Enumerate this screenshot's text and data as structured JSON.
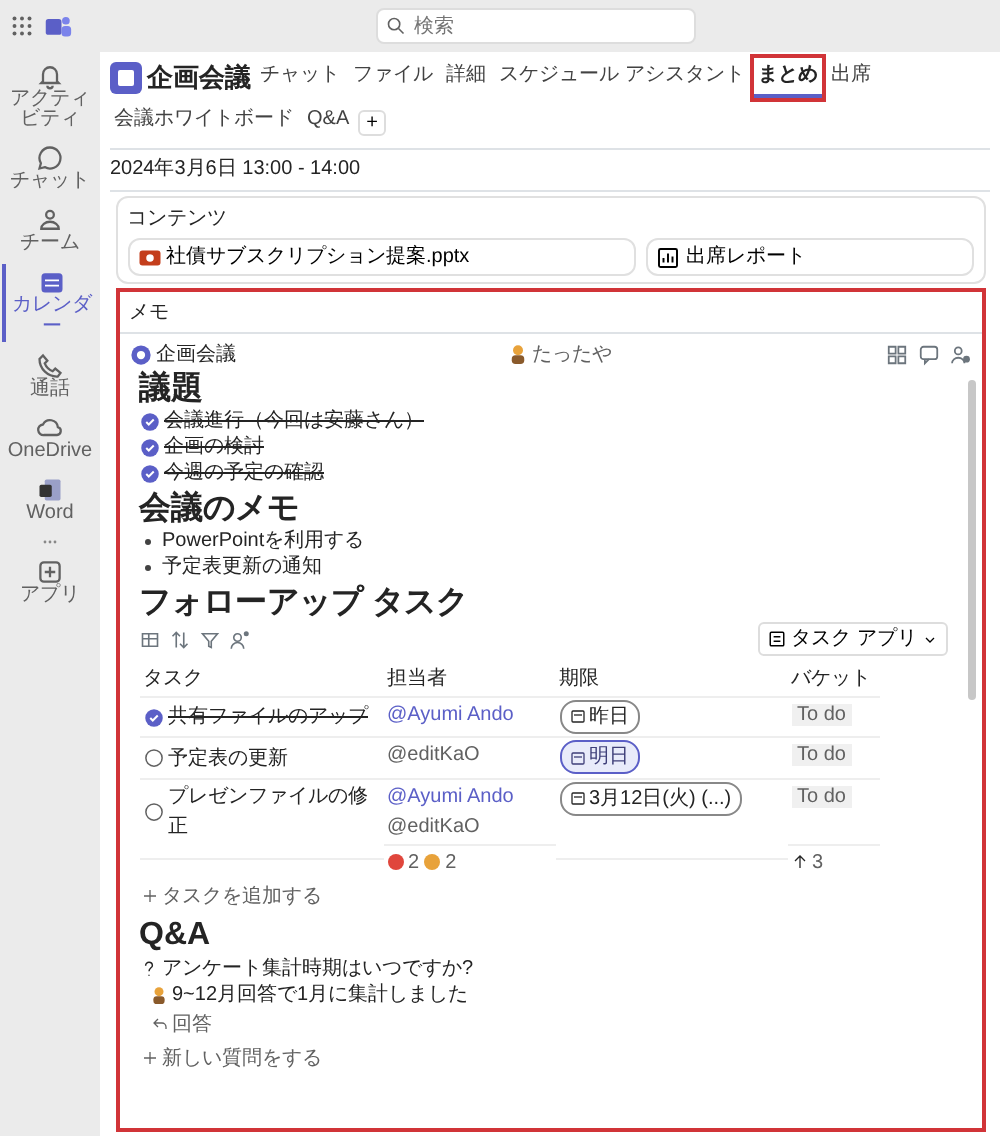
{
  "search": {
    "placeholder": "検索"
  },
  "rail": [
    {
      "label": "アクティビティ",
      "selected": false
    },
    {
      "label": "チャット",
      "selected": false
    },
    {
      "label": "チーム",
      "selected": false
    },
    {
      "label": "カレンダー",
      "selected": true
    },
    {
      "label": "通話",
      "selected": false
    },
    {
      "label": "OneDrive",
      "selected": false
    },
    {
      "label": "Word",
      "selected": false
    },
    {
      "label": "アプリ",
      "selected": false
    }
  ],
  "meeting": {
    "title": "企画会議",
    "date": "2024年3月6日 13:00 - 14:00",
    "tabs": [
      {
        "label": "チャット",
        "selected": false
      },
      {
        "label": "ファイル",
        "selected": false
      },
      {
        "label": "詳細",
        "selected": false
      },
      {
        "label": "スケジュール アシスタント",
        "selected": false
      },
      {
        "label": "まとめ",
        "selected": true
      },
      {
        "label": "出席",
        "selected": false
      },
      {
        "label": "会議ホワイトボード",
        "selected": false
      },
      {
        "label": "Q&A",
        "selected": false
      }
    ],
    "add_tab": "+"
  },
  "content": {
    "title": "コンテンツ",
    "files": [
      {
        "name": "社債サブスクリプション提案.pptx",
        "kind": "pptx"
      },
      {
        "name": "出席レポート",
        "kind": "report"
      }
    ]
  },
  "notes": {
    "title": "メモ",
    "highlighted": true,
    "workspace": "企画会議",
    "user": "たったや",
    "agenda": {
      "heading": "議題",
      "items": [
        {
          "text": "会議進行（今回は安藤さん）",
          "checked": true
        },
        {
          "text": "企画の検討",
          "checked": true
        },
        {
          "text": "今週の予定の確認",
          "checked": true
        }
      ]
    },
    "memo": {
      "heading": "会議のメモ",
      "bullets": [
        "PowerPointを利用する",
        "予定表更新の通知"
      ]
    },
    "tasks": {
      "heading": "フォローアップ タスク",
      "app_button": "タスク アプリ",
      "columns": [
        "タスク",
        "担当者",
        "期限",
        "バケット"
      ],
      "rows": [
        {
          "task": "共有ファイルのアップ",
          "done": true,
          "assignees": [
            "@Ayumi Ando"
          ],
          "due": "昨日",
          "due_highlighted": false,
          "bucket": "To do"
        },
        {
          "task": "予定表の更新",
          "done": false,
          "assignees": [
            "@editKaO"
          ],
          "due": "明日",
          "due_highlighted": true,
          "bucket": "To do"
        },
        {
          "task": "プレゼンファイルの修正",
          "done": false,
          "assignees": [
            "@Ayumi Ando",
            "@editKaO"
          ],
          "due": "3月12日(火) (...)",
          "due_highlighted": false,
          "bucket": "To do"
        }
      ],
      "summary": {
        "assignee_counts": [
          {
            "count": "2",
            "color": "#e0463c"
          },
          {
            "count": "2",
            "color": "#e8a23a"
          }
        ],
        "bucket_count": "3"
      },
      "add": "タスクを追加する"
    },
    "qa": {
      "heading": "Q&A",
      "question": "アンケート集計時期はいつですか?",
      "answer": "9~12月回答で1月に集計しました",
      "reply": "回答",
      "new_question": "新しい質問をする"
    }
  }
}
